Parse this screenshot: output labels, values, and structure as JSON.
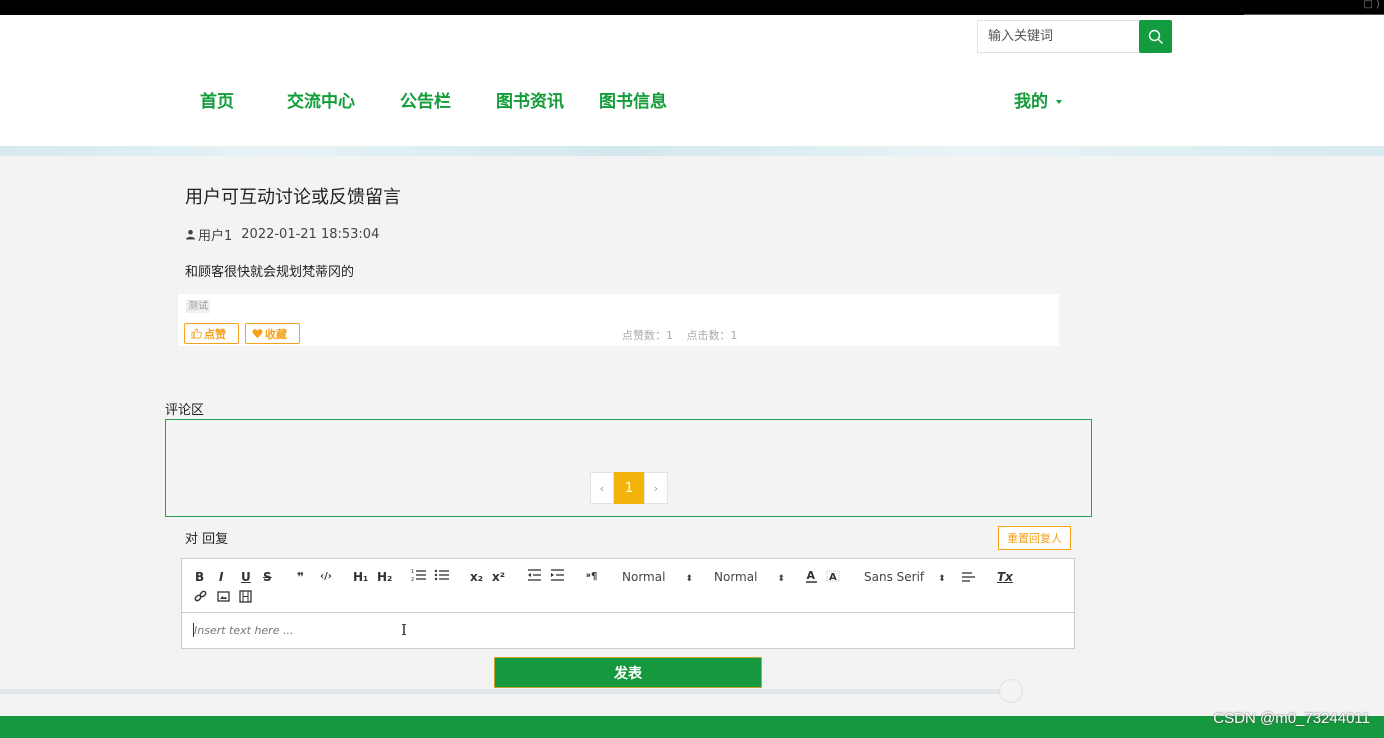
{
  "window": {
    "controls": "□ ⟩"
  },
  "search": {
    "placeholder": "输入关键词"
  },
  "nav": {
    "items": [
      "首页",
      "交流中心",
      "公告栏",
      "图书资讯",
      "图书信息"
    ],
    "mine": "我的"
  },
  "post": {
    "title": "用户可互动讨论或反馈留言",
    "author": "用户1",
    "date": "2022-01-21 18:53:04",
    "content": "和顾客很快就会规划梵蒂冈的",
    "tag": "测试",
    "like_label": "点赞",
    "favorite_label": "收藏",
    "like_count_text": "点赞数：1",
    "click_count_text": "点击数：1"
  },
  "comments": {
    "label": "评论区",
    "pager": {
      "prev": "‹",
      "current": "1",
      "next": "›"
    }
  },
  "reply": {
    "label": "对 回复",
    "reset_label": "重置回复人",
    "editor": {
      "bold": "B",
      "italic": "I",
      "underline": "U",
      "strike": "S",
      "blockquote": "❞",
      "code": "‹/›",
      "h1": "H₁",
      "h2": "H₂",
      "subscript": "x₂",
      "superscript": "x²",
      "rtl": "⁍¶",
      "size_select": "Normal",
      "header_select": "Normal",
      "font_select": "Sans Serif",
      "clean": "Tx",
      "placeholder": "Insert text here ..."
    },
    "submit_label": "发表"
  },
  "watermark": "CSDN @m0_73244011",
  "colors": {
    "accent": "#16993e",
    "orange": "#f5a11c",
    "pager_active": "#f5b40b"
  }
}
